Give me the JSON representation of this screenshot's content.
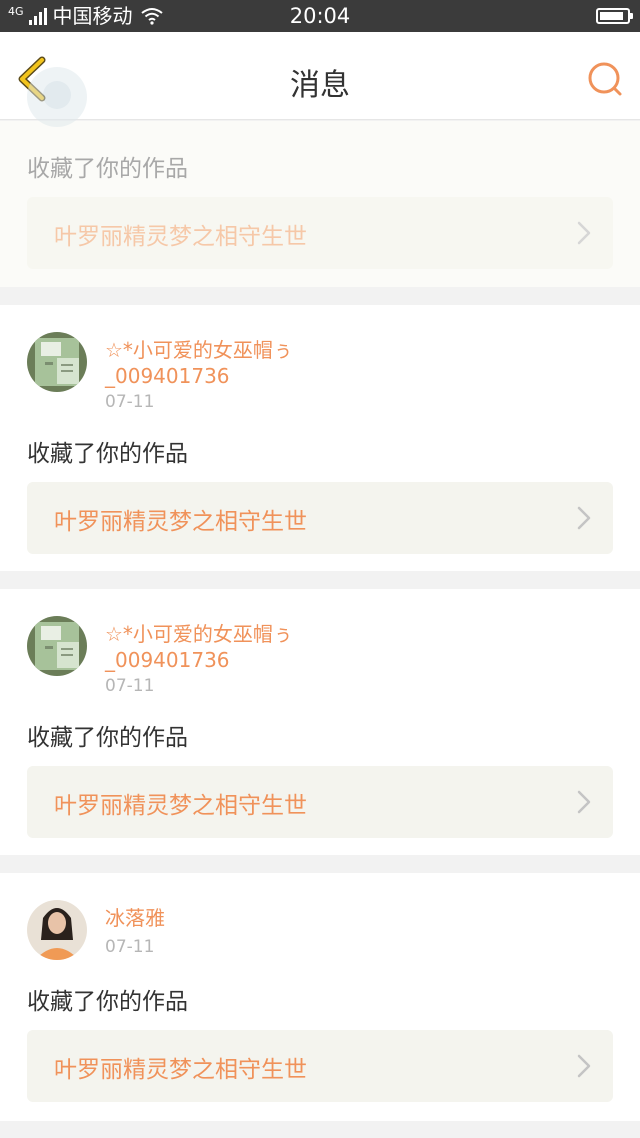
{
  "status_bar": {
    "network": "4G",
    "carrier": "中国移动",
    "time": "20:04",
    "battery_level": 0.9
  },
  "nav": {
    "title": "消息",
    "back_icon": "chevron-left-icon",
    "search_icon": "search-icon"
  },
  "messages": [
    {
      "user": "",
      "date": "",
      "action": "收藏了你的作品",
      "work_title": "叶罗丽精灵梦之相守生世"
    },
    {
      "user": "☆*小可爱的女巫帽ぅ_009401736",
      "date": "07-11",
      "action": "收藏了你的作品",
      "work_title": "叶罗丽精灵梦之相守生世"
    },
    {
      "user": "☆*小可爱的女巫帽ぅ_009401736",
      "date": "07-11",
      "action": "收藏了你的作品",
      "work_title": "叶罗丽精灵梦之相守生世"
    },
    {
      "user": "冰落雅",
      "date": "07-11",
      "action": "收藏了你的作品",
      "work_title": "叶罗丽精灵梦之相守生世"
    }
  ],
  "colors": {
    "accent": "#f0925a",
    "back_arrow": "#f2c41d",
    "status_bar_bg": "#3b3b3b",
    "page_bg": "#f2f2f2",
    "work_bg": "#f4f4ee"
  }
}
